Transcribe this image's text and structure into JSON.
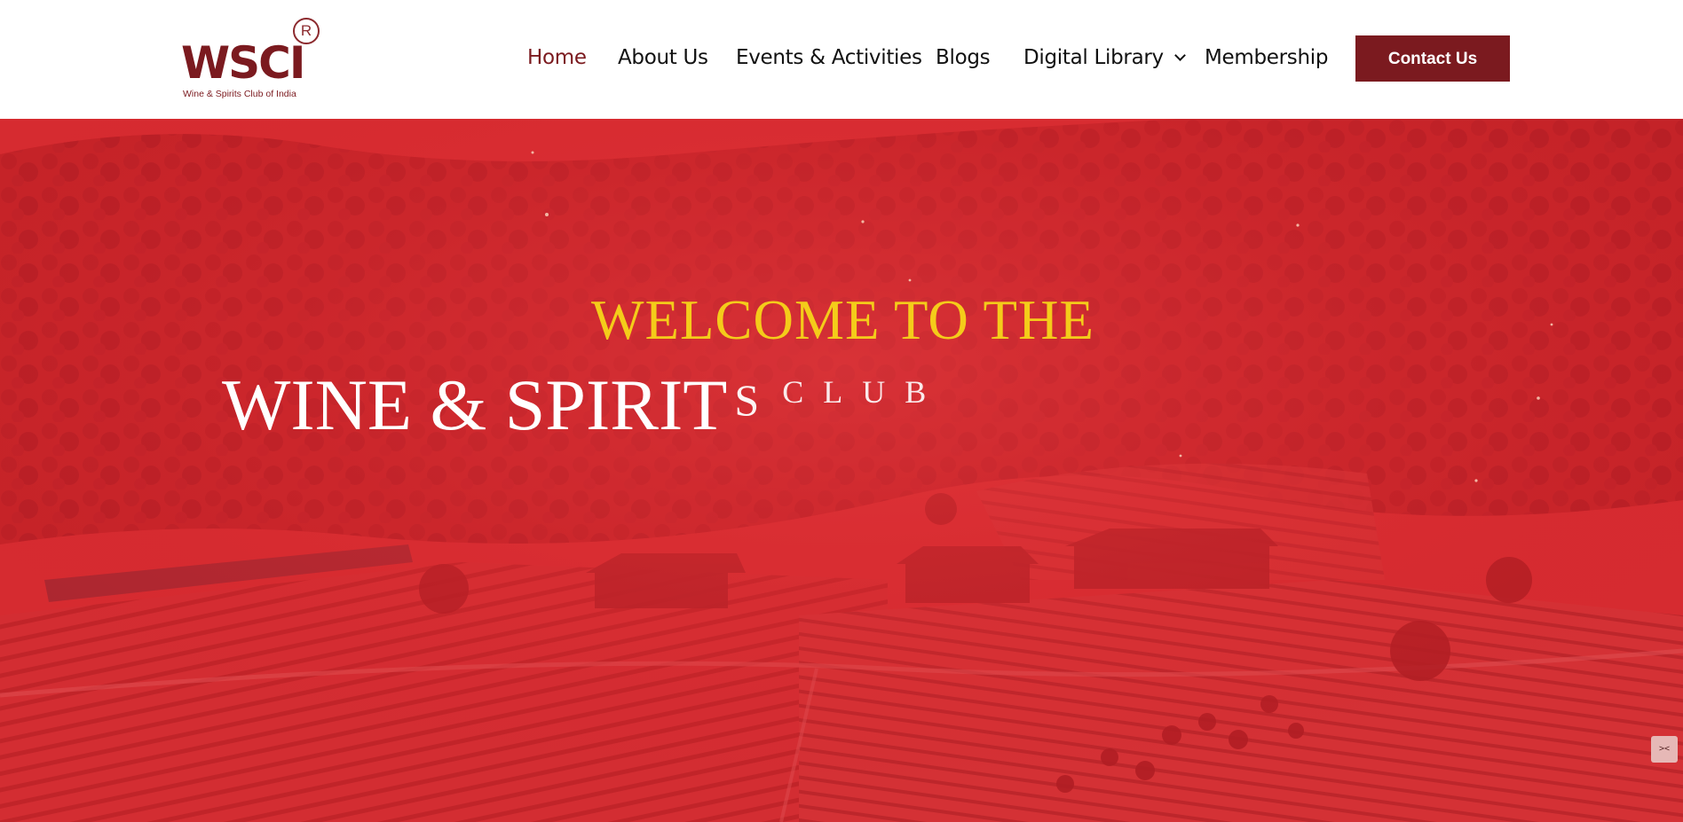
{
  "brand": {
    "logo_text": "WSCI",
    "registered_mark": "R",
    "tagline": "Wine & Spirits Club of India",
    "color": "#7b1a1f"
  },
  "nav": {
    "items": [
      {
        "label": "Home",
        "active": true
      },
      {
        "label": "About Us",
        "active": false
      },
      {
        "label": "Events & Activities",
        "active": false
      },
      {
        "label": "Blogs",
        "active": false
      },
      {
        "label": "Digital Library",
        "active": false,
        "has_dropdown": true
      },
      {
        "label": "Membership",
        "active": false
      }
    ],
    "contact_label": "Contact Us",
    "active_color": "#7b1a1f"
  },
  "hero": {
    "line1": "WELCOME TO THE",
    "line2": "WINE & SPIRIT",
    "line2_tail_s": "S",
    "line2_tail_rest": "CLUB",
    "line1_color": "#f4cc1a",
    "overlay_color": "#d8262c",
    "widget_icon": "collapse-arrows-icon",
    "widget_glyph": "><"
  }
}
